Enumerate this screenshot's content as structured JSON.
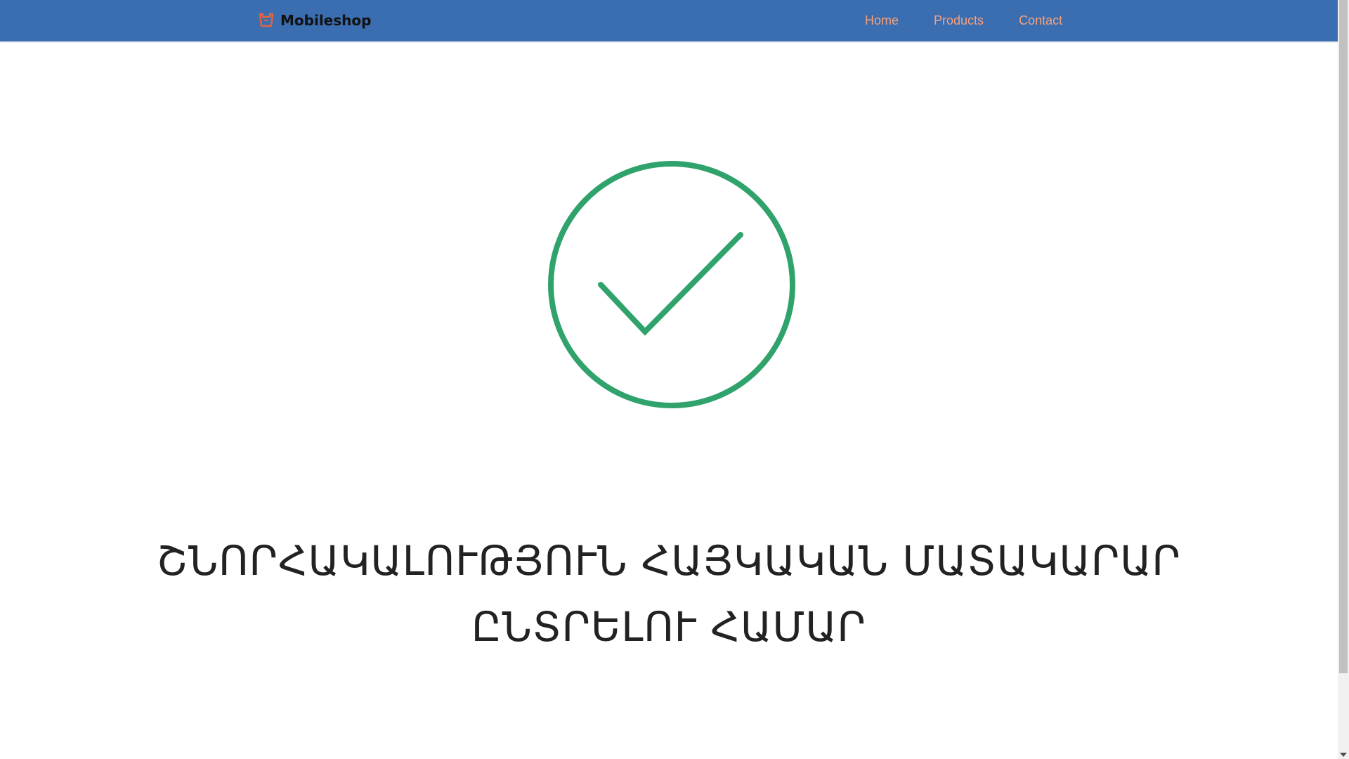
{
  "navbar": {
    "brand": "Mobileshop",
    "brand_icon": "shopping-basket-icon",
    "links": [
      {
        "label": "Home"
      },
      {
        "label": "Products"
      },
      {
        "label": "Contact"
      }
    ],
    "colors": {
      "background": "#3a6eb1",
      "link": "#f6a07c",
      "brand_icon": "#e8633d"
    }
  },
  "main": {
    "status_icon": "check-circle-icon",
    "status_color": "#2fa36b",
    "message": "ՇՆՈՐՀԱԿԱԼՈՒԹՅՈՒՆ ՀԱՅԿԱԿԱՆ ՄԱՏԱԿԱՐԱՐ ԸՆՏՐԵԼՈՒ ՀԱՄԱՐ"
  }
}
